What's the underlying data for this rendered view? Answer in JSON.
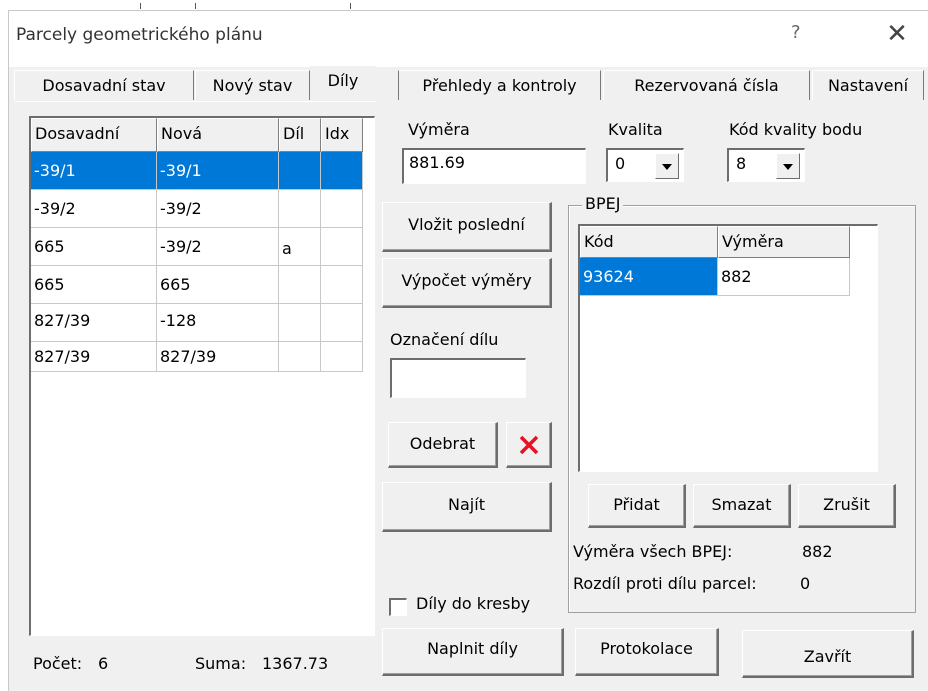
{
  "window": {
    "title": "Parcely geometrického plánu",
    "help_glyph": "?",
    "close_glyph": "✕"
  },
  "tabs": [
    "Dosavadní stav",
    "Nový stav",
    "Díly",
    "Přehledy a kontroly",
    "Rezervovaná čísla",
    "Nastavení"
  ],
  "active_tab": "Díly",
  "parts_table": {
    "columns": [
      "Dosavadní",
      "Nová",
      "Díl",
      "Idx"
    ],
    "rows": [
      [
        "-39/1",
        "-39/1",
        "",
        ""
      ],
      [
        "-39/2",
        "-39/2",
        "",
        ""
      ],
      [
        "665",
        "-39/2",
        "a",
        ""
      ],
      [
        "665",
        "665",
        "",
        ""
      ],
      [
        "827/39",
        "-128",
        "",
        ""
      ],
      [
        "827/39",
        "827/39",
        "",
        ""
      ]
    ],
    "selected_row": 0
  },
  "footer": {
    "count_label": "Počet:",
    "count_value": "6",
    "sum_label": "Suma:",
    "sum_value": "1367.73"
  },
  "area": {
    "label": "Výměra",
    "value": "881.69"
  },
  "quality": {
    "label": "Kvalita",
    "value": "0"
  },
  "point_quality": {
    "label": "Kód kvality bodu",
    "value": "8"
  },
  "buttons": {
    "insert_last": "Vložit poslední",
    "compute_area": "Výpočet výměry",
    "remove": "Odebrat",
    "find": "Najít",
    "fill_parts": "Naplnit díly",
    "protocol": "Protokolace",
    "close": "Zavřít"
  },
  "part_mark": {
    "label": "Označení dílu",
    "value": ""
  },
  "draw_parts": {
    "label": "Díly do kresby",
    "checked": false
  },
  "bpej": {
    "group_label": "BPEJ",
    "columns": [
      "Kód",
      "Výměra"
    ],
    "rows": [
      [
        "93624",
        "882"
      ]
    ],
    "buttons": {
      "add": "Přidat",
      "delete": "Smazat",
      "cancel": "Zrušit"
    },
    "total_label": "Výměra všech BPEJ:",
    "total_value": "882",
    "diff_label": "Rozdíl proti dílu parcel:",
    "diff_value": "0"
  },
  "colors": {
    "selection": "#0078d7",
    "delete_icon": "#e81123"
  }
}
